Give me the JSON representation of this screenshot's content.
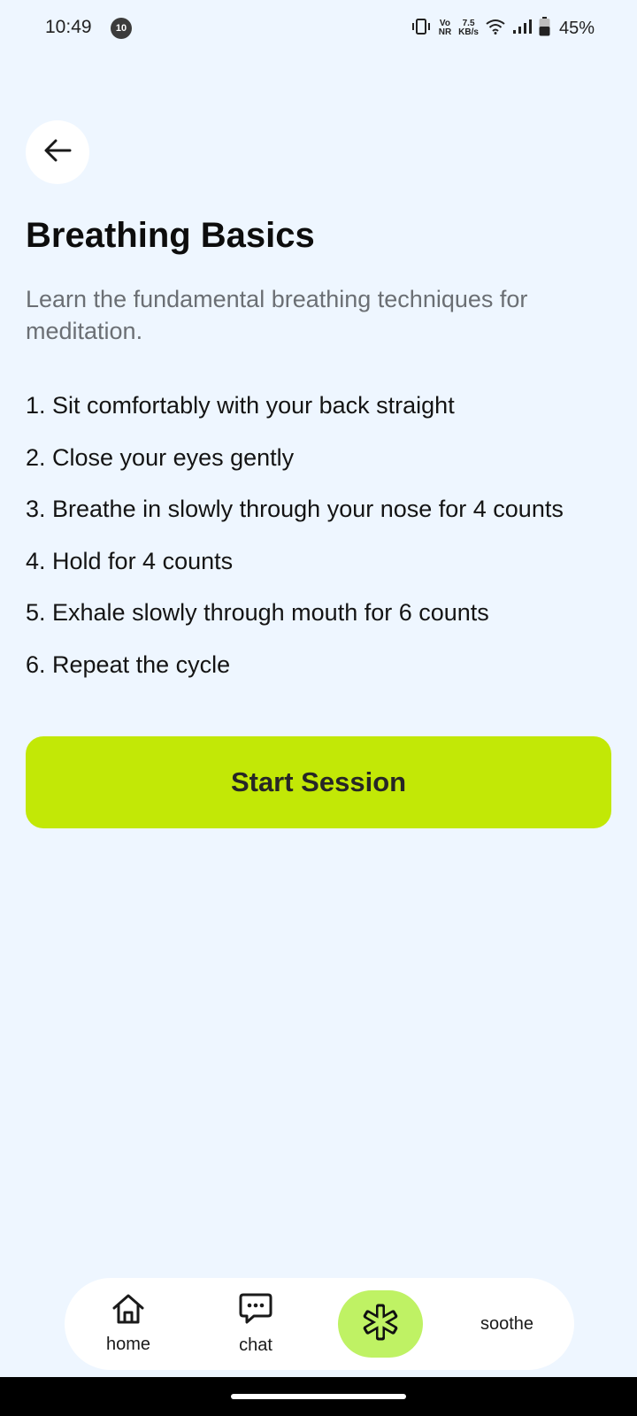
{
  "status_bar": {
    "time": "10:49",
    "notification_badge": "10",
    "volte_top": "Vo",
    "volte_bottom": "NR",
    "speed_value": "7.5",
    "speed_unit": "KB/s",
    "battery": "45%"
  },
  "page": {
    "title": "Breathing Basics",
    "subtitle": "Learn the fundamental breathing techniques for meditation.",
    "steps": [
      "1. Sit comfortably with your back straight",
      "2. Close your eyes gently",
      "3. Breathe in slowly through your nose for 4 counts",
      "4. Hold for 4 counts",
      "5. Exhale slowly through mouth for 6 counts",
      "6. Repeat the cycle"
    ],
    "start_button": "Start Session"
  },
  "nav": {
    "home": "home",
    "chat": "chat",
    "soothe": "soothe"
  },
  "colors": {
    "background": "#eef6ff",
    "accent": "#c2e806",
    "nav_active": "#bff264"
  },
  "icons": [
    "back-arrow-icon",
    "home-icon",
    "chat-icon",
    "asterisk-icon",
    "wifi-icon",
    "signal-icon",
    "battery-icon",
    "vibrate-icon"
  ]
}
